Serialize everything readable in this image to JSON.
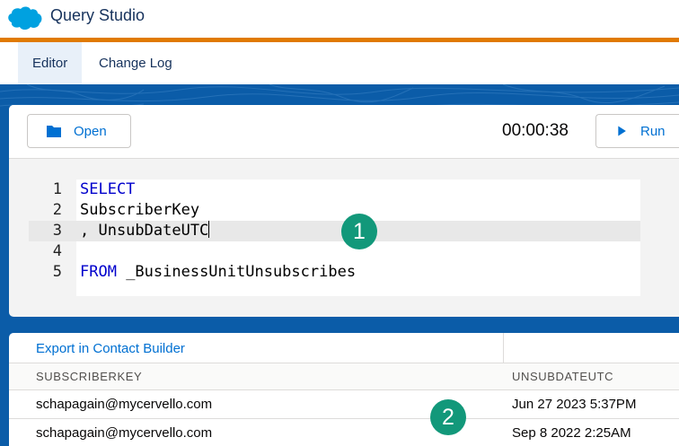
{
  "app": {
    "title": "Query Studio",
    "logo_icon": "cloud-logo-icon",
    "brand_color": "#00a1e0",
    "accent_color": "#e07a00"
  },
  "tabs": [
    {
      "label": "Editor",
      "active": true
    },
    {
      "label": "Change Log",
      "active": false
    }
  ],
  "toolbar": {
    "open_label": "Open",
    "open_icon": "folder-icon",
    "timer": "00:00:38",
    "run_label": "Run",
    "run_icon": "play-icon"
  },
  "editor": {
    "lines": [
      {
        "num": "1",
        "keyword": "SELECT",
        "text": ""
      },
      {
        "num": "2",
        "keyword": "",
        "text": "SubscriberKey"
      },
      {
        "num": "3",
        "keyword": "",
        "text": ", UnsubDateUTC"
      },
      {
        "num": "4",
        "keyword": "",
        "text": ""
      },
      {
        "num": "5",
        "keyword": "FROM",
        "text": " _BusinessUnitUnsubscribes"
      }
    ],
    "active_line": 3
  },
  "markers": {
    "one": "1",
    "two": "2"
  },
  "results": {
    "export_label": "Export in Contact Builder",
    "columns": [
      "SUBSCRIBERKEY",
      "UNSUBDATEUTC"
    ],
    "rows": [
      [
        "schapagain@mycervello.com",
        "Jun 27 2023 5:37PM"
      ],
      [
        "schapagain@mycervello.com",
        "Sep 8 2022 2:25AM"
      ]
    ]
  }
}
